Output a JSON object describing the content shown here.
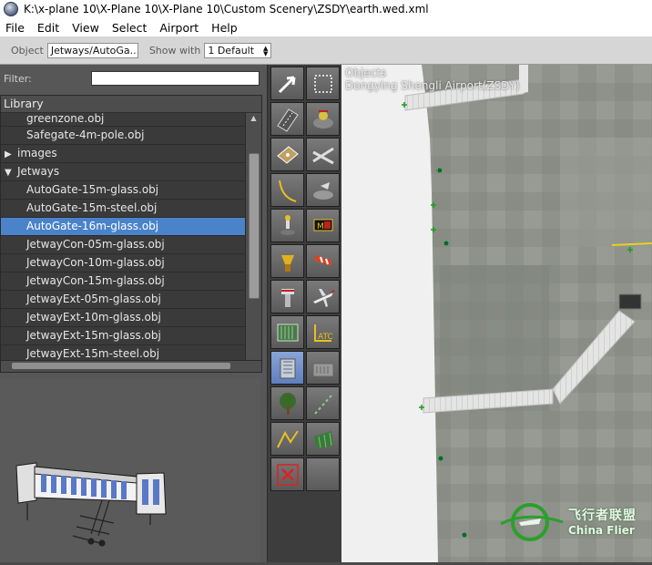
{
  "window": {
    "title": "K:\\x-plane 10\\X-Plane 10\\X-Plane 10\\Custom Scenery\\ZSDY\\earth.wed.xml"
  },
  "menu": [
    "File",
    "Edit",
    "View",
    "Select",
    "Airport",
    "Help"
  ],
  "toolbar": {
    "object_label": "Object",
    "object_value": "Jetways/AutoGa...",
    "show_with_label": "Show with",
    "show_with_value": "1 Default"
  },
  "library": {
    "filter_label": "Filter:",
    "filter_value": "",
    "header": "Library",
    "items": [
      {
        "label": "greenzone.obj",
        "type": "file",
        "selected": false
      },
      {
        "label": "Safegate-4m-pole.obj",
        "type": "file",
        "selected": false
      },
      {
        "label": "images",
        "type": "folder-closed",
        "selected": false
      },
      {
        "label": "Jetways",
        "type": "folder-open",
        "selected": false
      },
      {
        "label": "AutoGate-15m-glass.obj",
        "type": "file",
        "selected": false
      },
      {
        "label": "AutoGate-15m-steel.obj",
        "type": "file",
        "selected": false
      },
      {
        "label": "AutoGate-16m-glass.obj",
        "type": "file",
        "selected": true
      },
      {
        "label": "JetwayCon-05m-glass.obj",
        "type": "file",
        "selected": false
      },
      {
        "label": "JetwayCon-10m-glass.obj",
        "type": "file",
        "selected": false
      },
      {
        "label": "JetwayCon-15m-glass.obj",
        "type": "file",
        "selected": false
      },
      {
        "label": "JetwayExt-05m-glass.obj",
        "type": "file",
        "selected": false
      },
      {
        "label": "JetwayExt-10m-glass.obj",
        "type": "file",
        "selected": false
      },
      {
        "label": "JetwayExt-15m-glass.obj",
        "type": "file",
        "selected": false
      },
      {
        "label": "JetwayExt-15m-steel.obj",
        "type": "file",
        "selected": false
      }
    ]
  },
  "tools": [
    {
      "icon": "pointer-arrow-icon",
      "active": false
    },
    {
      "icon": "marquee-select-icon",
      "active": false
    },
    {
      "icon": "runway-icon",
      "active": false
    },
    {
      "icon": "helipad-icon",
      "active": false
    },
    {
      "icon": "pavement-icon",
      "active": false
    },
    {
      "icon": "taxiway-lines-icon",
      "active": false
    },
    {
      "icon": "taxi-route-icon",
      "active": false
    },
    {
      "icon": "ramp-start-icon",
      "active": false
    },
    {
      "icon": "light-fixture-icon",
      "active": false
    },
    {
      "icon": "taxi-sign-icon",
      "active": false
    },
    {
      "icon": "airport-beacon-icon",
      "active": false
    },
    {
      "icon": "windsock-icon",
      "active": false
    },
    {
      "icon": "tower-viewpoint-icon",
      "active": false
    },
    {
      "icon": "aircraft-icon",
      "active": false
    },
    {
      "icon": "boundary-icon",
      "active": false
    },
    {
      "icon": "atc-icon",
      "active": false,
      "text": "ATC"
    },
    {
      "icon": "object-icon",
      "active": true
    },
    {
      "icon": "facade-icon",
      "active": false
    },
    {
      "icon": "forest-icon",
      "active": false
    },
    {
      "icon": "string-icon",
      "active": false
    },
    {
      "icon": "line-icon",
      "active": false
    },
    {
      "icon": "polygon-icon",
      "active": false
    },
    {
      "icon": "exclusion-zone-icon",
      "active": false
    },
    {
      "icon": "empty-slot-icon",
      "active": false
    }
  ],
  "map": {
    "tool_name": "Objects",
    "airport_name": "Dongying Shengli Airport(ZSDY)"
  },
  "watermark": {
    "cn": "飞行者联盟",
    "en": "China Flier"
  }
}
